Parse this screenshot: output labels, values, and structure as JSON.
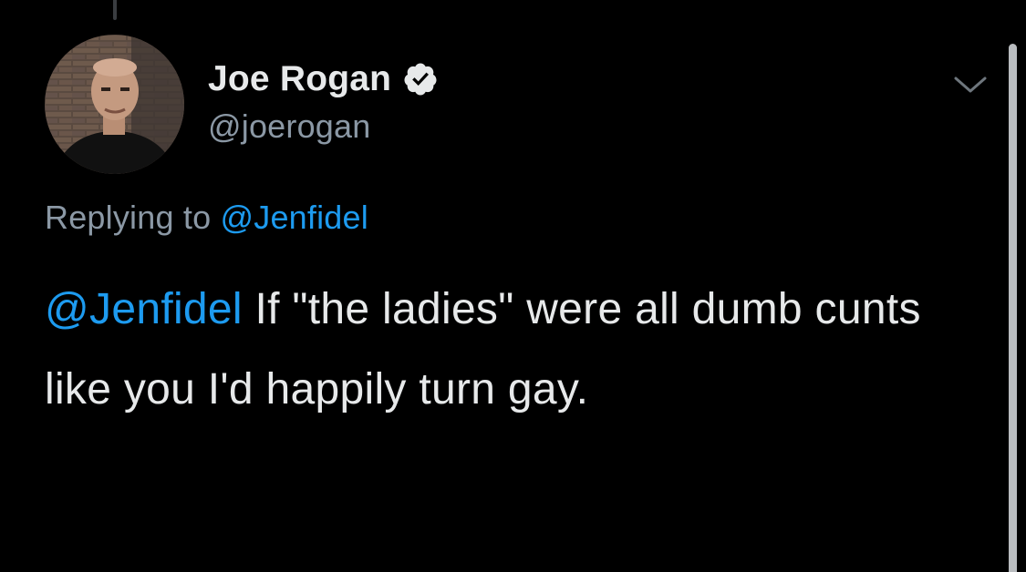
{
  "tweet": {
    "author": {
      "display_name": "Joe Rogan",
      "handle": "@joerogan",
      "verified": true,
      "avatar_icon": "profile-photo"
    },
    "reply_context": {
      "prefix": "Replying to ",
      "mention": "@Jenfidel"
    },
    "body": {
      "mention": "@Jenfidel",
      "text": " If \"the ladies\" were all dumb cunts like you I'd happily turn gay."
    },
    "menu_icon": "chevron-down-icon"
  },
  "colors": {
    "background": "#000000",
    "primary_text": "#e7e9ea",
    "secondary_text": "#8b98a5",
    "accent": "#1d9bf0"
  }
}
